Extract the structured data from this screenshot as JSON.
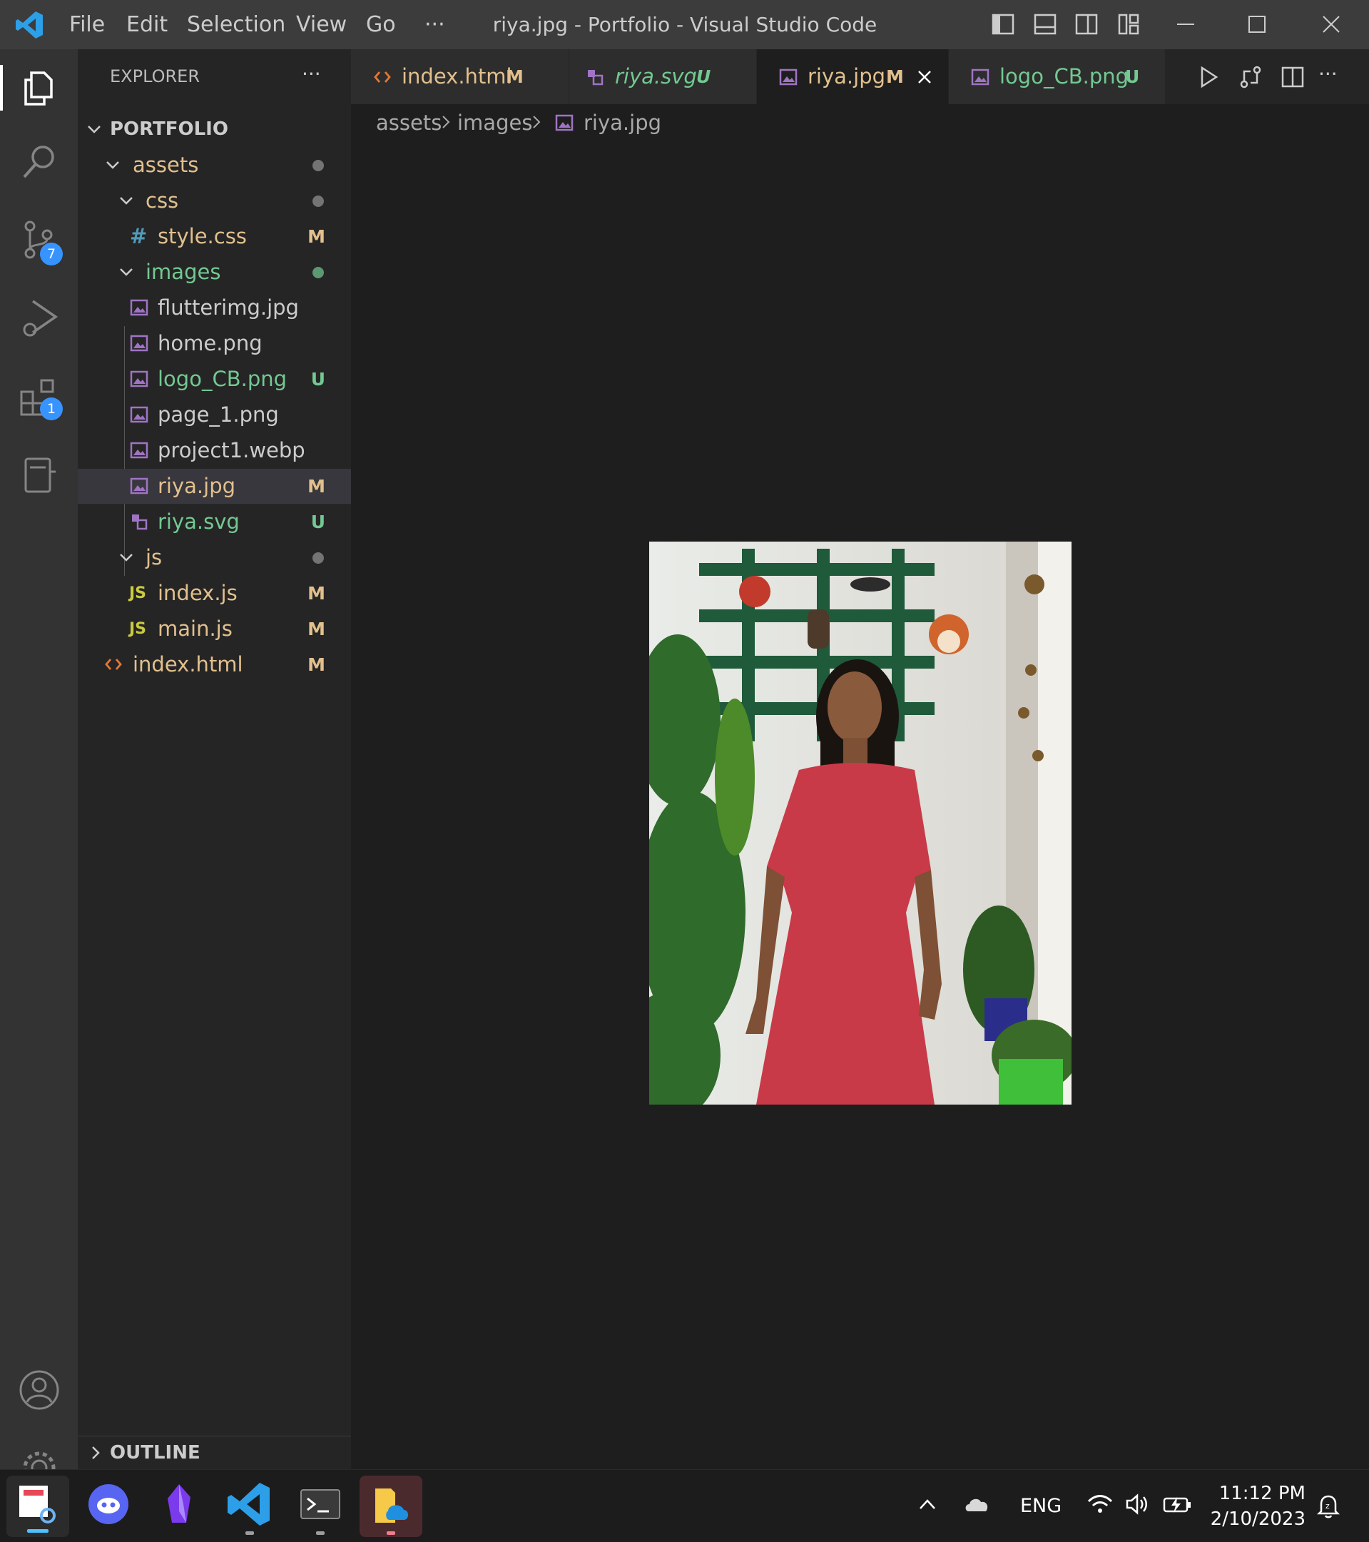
{
  "titlebar": {
    "menu": [
      "File",
      "Edit",
      "Selection",
      "View",
      "Go",
      "···"
    ],
    "title": "riya.jpg - Portfolio - Visual Studio Code"
  },
  "activity_bar": {
    "source_control_badge": "7",
    "extensions_badge": "1"
  },
  "sidebar": {
    "header": "EXPLORER",
    "more": "···",
    "root": "PORTFOLIO",
    "outline": "OUTLINE",
    "tree": [
      {
        "label": "assets",
        "status": ""
      },
      {
        "label": "css",
        "status": ""
      },
      {
        "label": "style.css",
        "status": "M"
      },
      {
        "label": "images",
        "status": ""
      },
      {
        "label": "flutterimg.jpg",
        "status": ""
      },
      {
        "label": "home.png",
        "status": ""
      },
      {
        "label": "logo_CB.png",
        "status": "U"
      },
      {
        "label": "page_1.png",
        "status": ""
      },
      {
        "label": "project1.webp",
        "status": ""
      },
      {
        "label": "riya.jpg",
        "status": "M"
      },
      {
        "label": "riya.svg",
        "status": "U"
      },
      {
        "label": "js",
        "status": ""
      },
      {
        "label": "index.js",
        "status": "M"
      },
      {
        "label": "main.js",
        "status": "M"
      },
      {
        "label": "index.html",
        "status": "M"
      }
    ],
    "js_icon": "JS",
    "css_icon": "#"
  },
  "tabs": [
    {
      "label": "index.html",
      "status": "M"
    },
    {
      "label": "riya.svg",
      "status": "U"
    },
    {
      "label": "riya.jpg",
      "status": "M"
    },
    {
      "label": "logo_CB.png",
      "status": "U"
    }
  ],
  "tab_actions_more": "···",
  "breadcrumb": [
    "assets",
    "images",
    "riya.jpg"
  ],
  "taskbar": {
    "language": "ENG",
    "time": "11:12 PM",
    "date": "2/10/2023"
  },
  "colors": {
    "modified": "#e2c08d",
    "untracked": "#73c991",
    "accent": "#3794ff",
    "html_icon": "#e37933",
    "image_icon": "#a074c4",
    "js_icon": "#cbcb41",
    "css_icon": "#519aba"
  }
}
